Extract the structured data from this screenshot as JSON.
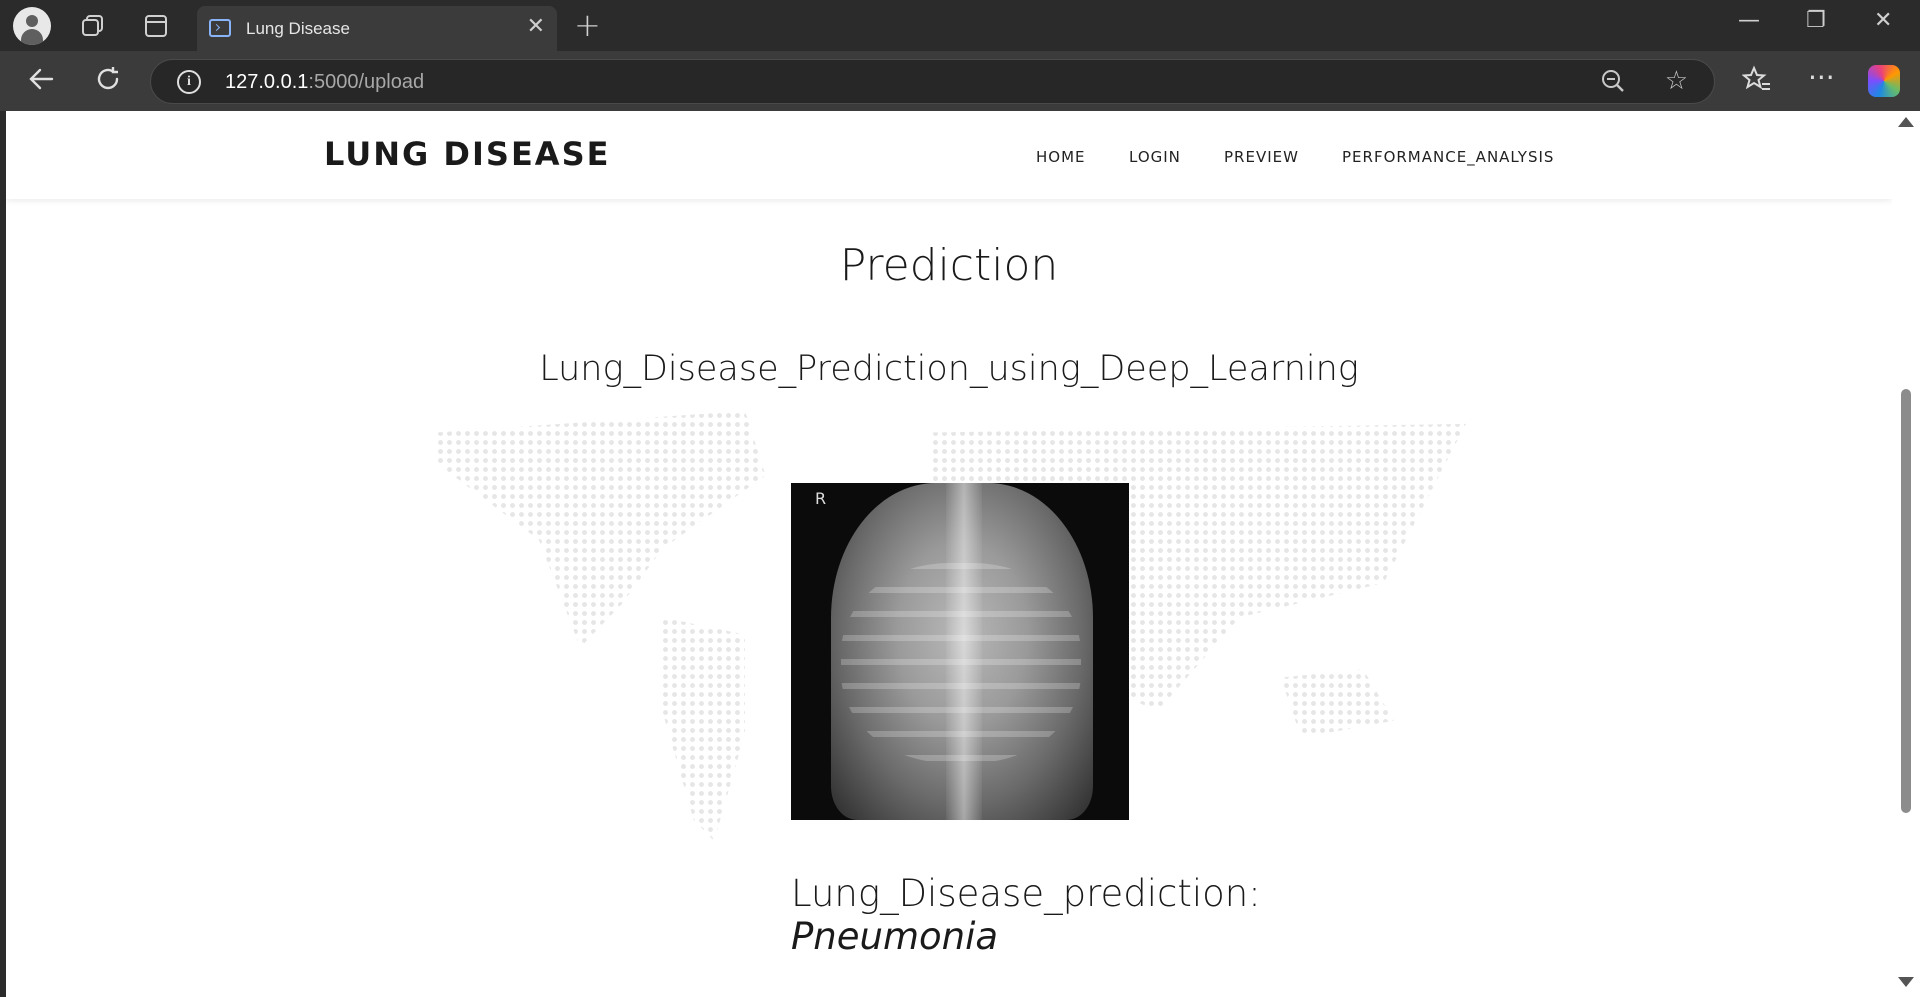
{
  "browser": {
    "tab_title": "Lung Disease",
    "url_host": "127.0.0.1",
    "url_path": ":5000/upload",
    "icons": [
      "profile-icon",
      "workspaces-icon",
      "tab-actions-icon",
      "back-icon",
      "refresh-icon",
      "info-icon",
      "zoom-out-icon",
      "favorite-star-icon",
      "favorites-icon",
      "more-icon",
      "copilot-icon"
    ]
  },
  "site": {
    "brand": "LUNG DISEASE",
    "nav": [
      "HOME",
      "LOGIN",
      "PREVIEW",
      "PERFORMANCE_ANALYSIS"
    ]
  },
  "main": {
    "title": "Prediction",
    "subtitle": "Lung_Disease_Prediction_using_Deep_Learning",
    "xray_marker": "R",
    "result_label": "Lung_Disease_prediction:",
    "result_value": "Pneumonia"
  }
}
